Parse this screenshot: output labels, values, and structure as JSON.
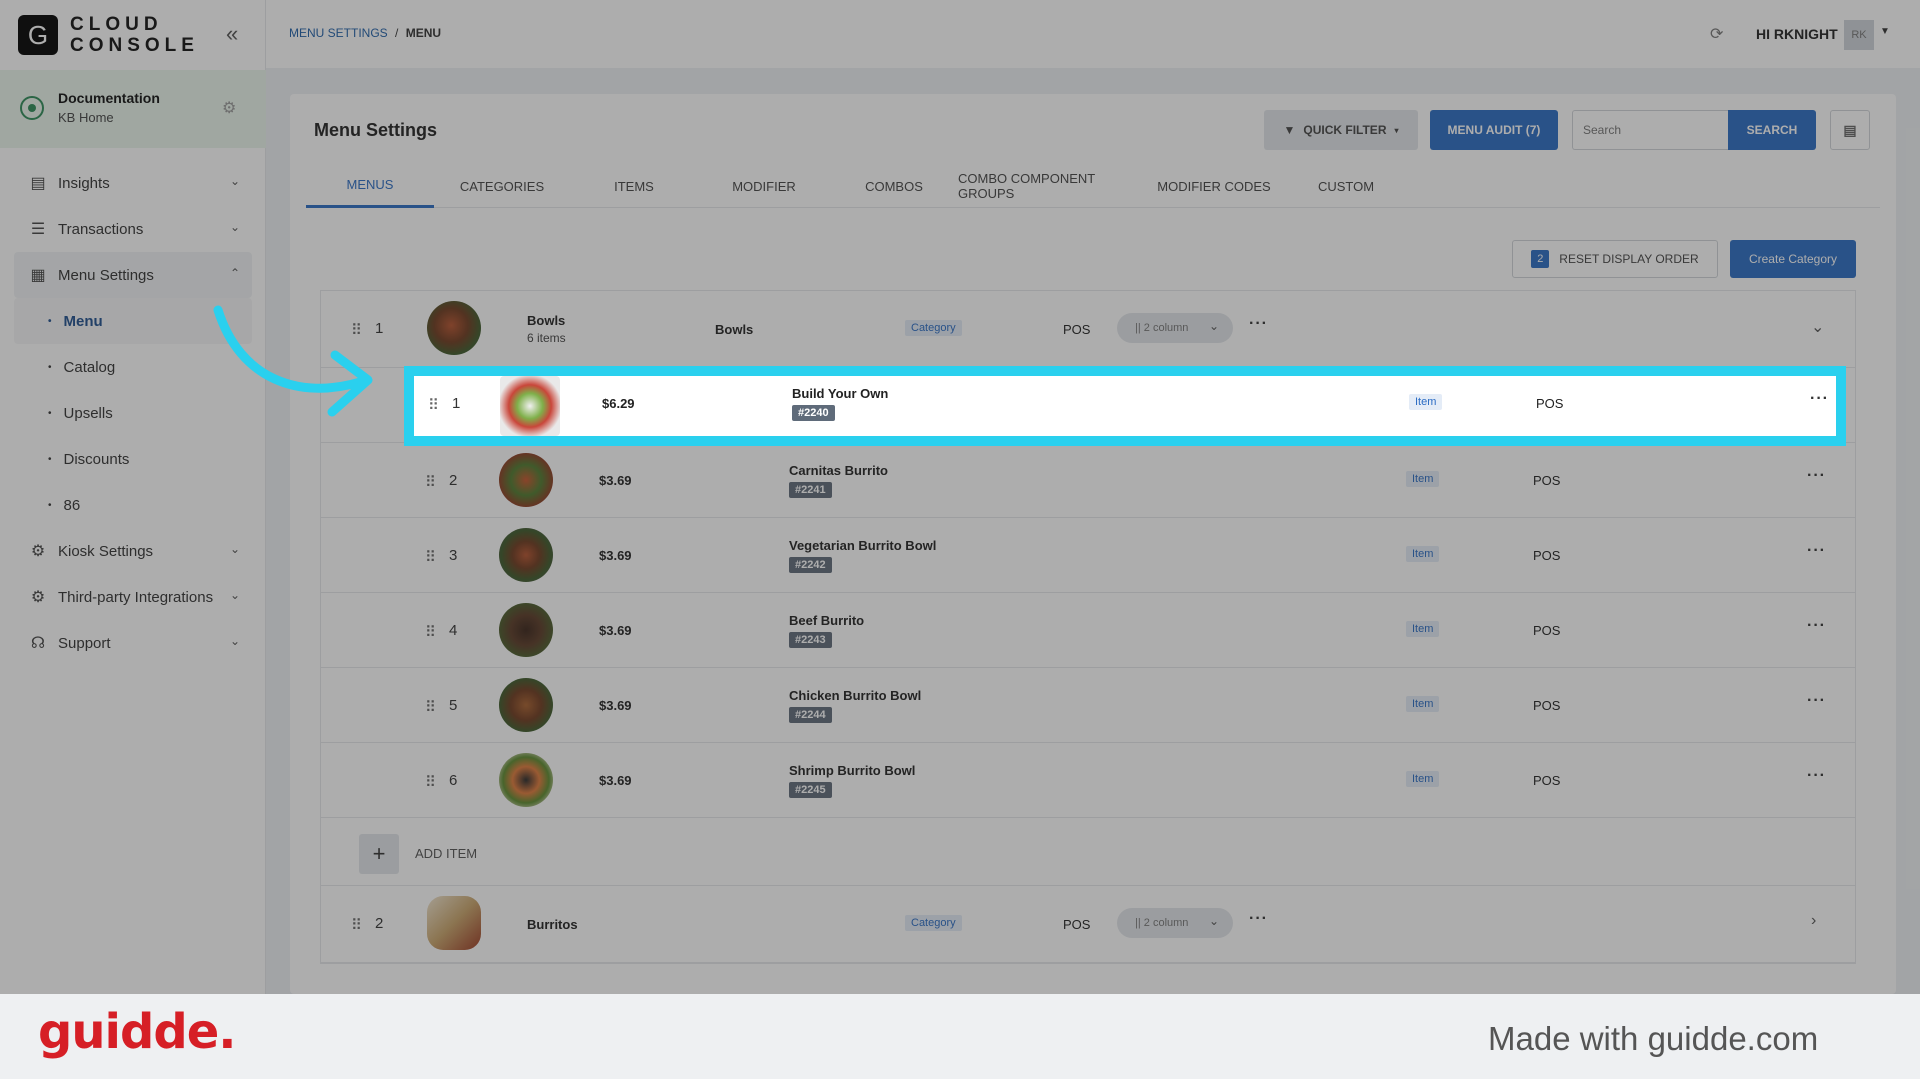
{
  "app": {
    "logo_letter": "G",
    "logo_line1": "CLOUD",
    "logo_line2": "CONSOLE"
  },
  "location": {
    "name": "Documentation",
    "sub": "KB Home"
  },
  "sidebar": {
    "items": [
      {
        "label": "Insights"
      },
      {
        "label": "Transactions"
      },
      {
        "label": "Menu Settings"
      },
      {
        "label": "Kiosk Settings"
      },
      {
        "label": "Third-party Integrations"
      },
      {
        "label": "Support"
      }
    ],
    "sub_items": [
      {
        "label": "Menu"
      },
      {
        "label": "Catalog"
      },
      {
        "label": "Upsells"
      },
      {
        "label": "Discounts"
      },
      {
        "label": "86"
      }
    ]
  },
  "header": {
    "breadcrumb": [
      "MENU SETTINGS",
      "MENU"
    ],
    "breadcrumb_sep": "/",
    "greeting": "HI RKNIGHT",
    "avatar": "RK"
  },
  "page": {
    "title": "Menu Settings",
    "quick_filter": "QUICK FILTER",
    "menu_audit": "MENU AUDIT (7)",
    "search_placeholder": "Search",
    "search_button": "SEARCH",
    "tabs": [
      "MENUS",
      "CATEGORIES",
      "ITEMS",
      "MODIFIER",
      "COMBOS",
      "COMBO COMPONENT GROUPS",
      "MODIFIER CODES",
      "CUSTOM"
    ],
    "reset_count": "2",
    "reset_label": "RESET DISPLAY ORDER",
    "create_label": "Create Category",
    "add_item_label": "ADD ITEM",
    "add_item_symbol": "+"
  },
  "categories": [
    {
      "order": "1",
      "name": "Bowls",
      "count": "6 items",
      "label": "Bowls",
      "type": "Category",
      "channel": "POS",
      "columns": "|| 2 column"
    },
    {
      "order": "2",
      "name": "Burritos",
      "count": "",
      "label": "",
      "type": "Category",
      "channel": "POS",
      "columns": "|| 2 column"
    }
  ],
  "items": [
    {
      "order": "1",
      "price": "$6.29",
      "name": "Build Your Own",
      "code": "#2240",
      "type": "Item",
      "channel": "POS"
    },
    {
      "order": "2",
      "price": "$3.69",
      "name": "Carnitas Burrito",
      "code": "#2241",
      "type": "Item",
      "channel": "POS"
    },
    {
      "order": "3",
      "price": "$3.69",
      "name": "Vegetarian Burrito Bowl",
      "code": "#2242",
      "type": "Item",
      "channel": "POS"
    },
    {
      "order": "4",
      "price": "$3.69",
      "name": "Beef Burrito",
      "code": "#2243",
      "type": "Item",
      "channel": "POS"
    },
    {
      "order": "5",
      "price": "$3.69",
      "name": "Chicken Burrito Bowl",
      "code": "#2244",
      "type": "Item",
      "channel": "POS"
    },
    {
      "order": "6",
      "price": "$3.69",
      "name": "Shrimp Burrito Bowl",
      "code": "#2245",
      "type": "Item",
      "channel": "POS"
    }
  ],
  "footer": {
    "brand": "guidde.",
    "made_with": "Made with guidde.com"
  },
  "colors": {
    "accent": "#2b6cc4",
    "highlight": "#2ad0ee",
    "brand_red": "#d61f26"
  }
}
